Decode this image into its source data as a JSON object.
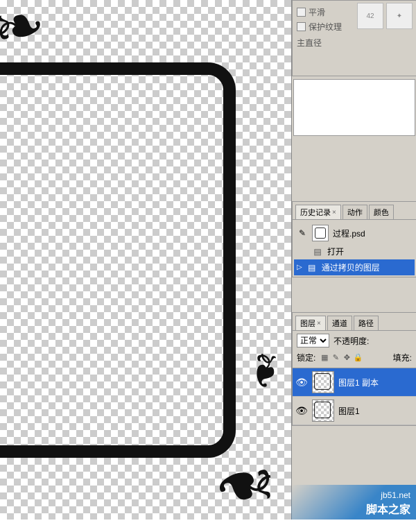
{
  "brush": {
    "smooth": "平滑",
    "protect_texture": "保护纹理",
    "main_diameter": "主直径",
    "thumb_a": "42",
    "thumb_b": "✦"
  },
  "history_panel": {
    "tabs": {
      "history": "历史记录",
      "actions": "动作",
      "color": "颜色"
    },
    "close_glyph": "×",
    "doc_name": "过程.psd",
    "open_step": "打开",
    "copy_layer_step": "通过拷贝的图层",
    "arrow": "▷"
  },
  "layers_panel": {
    "tabs": {
      "layers": "图层",
      "channels": "通道",
      "paths": "路径"
    },
    "blend_mode": "正常",
    "opacity_label": "不透明度:",
    "lock_label": "锁定:",
    "fill_label": "填充:",
    "layer_copy": "图层1 副本",
    "layer_1": "图层1",
    "eye": "👁"
  },
  "watermark": {
    "url": "jb51.net",
    "name": "脚本之家"
  }
}
